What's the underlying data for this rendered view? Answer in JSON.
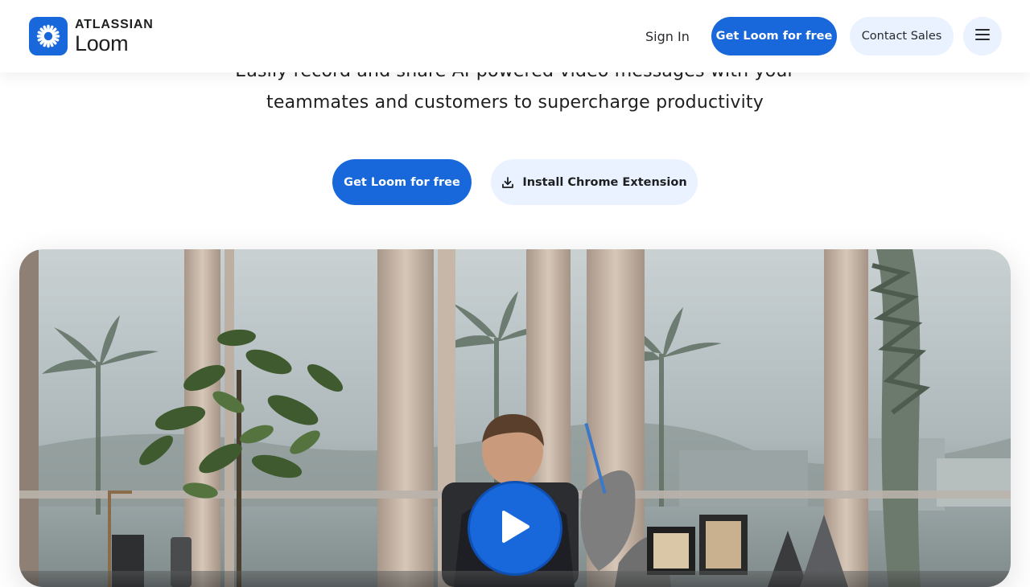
{
  "header": {
    "logo": {
      "brand": "ATLASSIAN",
      "product": "Loom",
      "icon": "loom-asterisk-icon"
    },
    "nav": {
      "sign_in": "Sign In",
      "get_loom": "Get Loom for free",
      "contact_sales": "Contact Sales",
      "menu_icon": "hamburger-menu-icon"
    }
  },
  "hero": {
    "subtitle_line1": "Easily record and share AI-powered video messages with your",
    "subtitle_line2": "teammates and customers to supercharge productivity",
    "cta_primary": "Get Loom for free",
    "cta_secondary": "Install Chrome Extension",
    "cta_secondary_icon": "download-icon"
  },
  "video": {
    "play_icon": "play-icon"
  },
  "colors": {
    "brand_blue": "#1868db",
    "light_blue": "#e9f2fe",
    "text_dark": "#1e1f21"
  }
}
